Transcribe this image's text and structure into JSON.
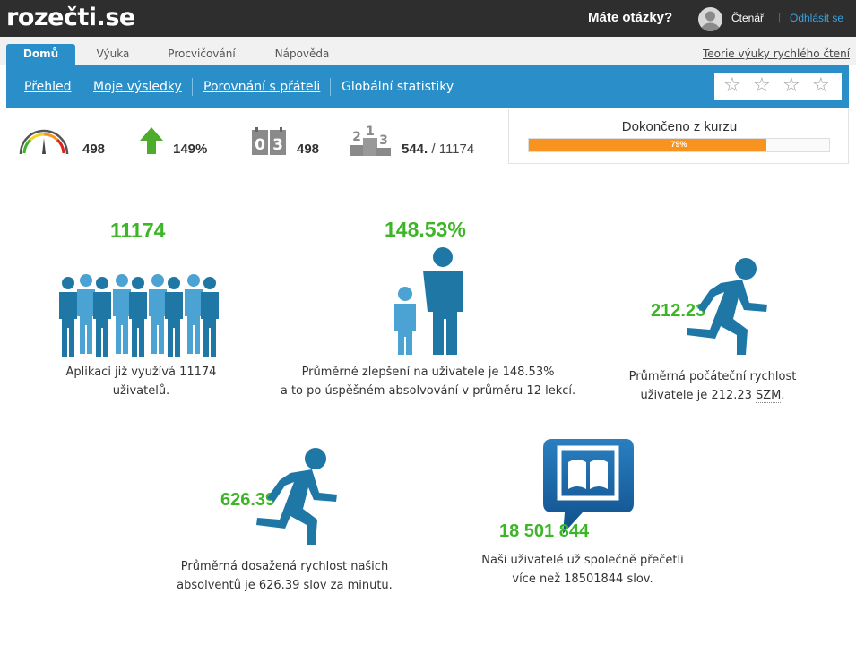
{
  "topbar": {
    "logo": "rozečti.se",
    "questions": "Máte otázky?",
    "username": "Čtenář",
    "separator": "|",
    "logout": "Odhlásit se"
  },
  "tabs": [
    {
      "label": "Domů",
      "active": true
    },
    {
      "label": "Výuka",
      "active": false
    },
    {
      "label": "Procvičování",
      "active": false
    },
    {
      "label": "Nápověda",
      "active": false
    }
  ],
  "theory_link": "Teorie výuky rychlého čtení",
  "subnav": [
    {
      "label": "Přehled"
    },
    {
      "label": "Moje výsledky"
    },
    {
      "label": "Porovnání s přáteli"
    },
    {
      "label": "Globální statistiky"
    }
  ],
  "rating": {
    "stars_total": 4,
    "stars_filled": 0
  },
  "stats": {
    "speed": "498",
    "improvement": "149%",
    "days": "498",
    "rank": "544.",
    "rank_total": "/ 11174",
    "calendar_digits": "03",
    "podium_digits": "213"
  },
  "course": {
    "title": "Dokončeno z kurzu",
    "progress_label": "79%",
    "progress_fraction": 0.79
  },
  "global": {
    "users": {
      "value": "11174",
      "caption": "Aplikaci již využívá 11174 uživatelů."
    },
    "improvement": {
      "value": "148.53%",
      "caption_line1": "Průměrné zlepšení na uživatele je 148.53%",
      "caption_line2": "a to po úspěšném absolvování v průměru 12 lekcí."
    },
    "start_speed": {
      "value": "212.23",
      "caption_line1": "Průměrná počáteční rychlost",
      "caption_line2_pre": "uživatele je 212.23 ",
      "caption_abbr": "SZM",
      "caption_line2_post": "."
    },
    "end_speed": {
      "value": "626.39",
      "caption_line1": "Průměrná dosažená rychlost našich",
      "caption_line2": "absolventů je 626.39 slov za minutu."
    },
    "words": {
      "value": "18 501 844",
      "caption_line1": "Naši uživatelé už společně přečetli",
      "caption_line2": "více než 18501844 slov."
    }
  },
  "colors": {
    "accent": "#2a8fc8",
    "green": "#3cb526",
    "orange": "#f7931e",
    "figure_dark": "#1f77a6",
    "figure_light": "#4ba3d3",
    "topbar": "#2e2e2e"
  }
}
